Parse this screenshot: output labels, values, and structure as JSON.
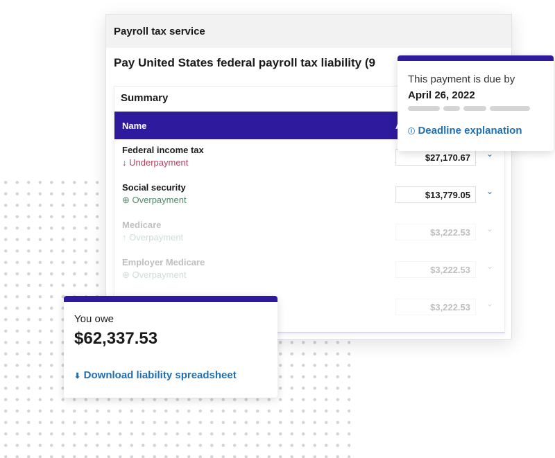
{
  "window": {
    "header": "Payroll tax service",
    "title": "Pay United States federal payroll tax liability (9"
  },
  "summary": {
    "heading": "Summary",
    "columns": [
      "Name",
      "A"
    ],
    "rows": [
      {
        "name": "Federal income tax",
        "status": "Underpayment",
        "status_icon": "arrow-down-icon",
        "amount": "$27,170.67",
        "enabled": true
      },
      {
        "name": "Social security",
        "status": "Overpayment",
        "status_icon": "plus-circle-icon",
        "amount": "$13,779.05",
        "enabled": true
      },
      {
        "name": "Medicare",
        "status": "Overpayment",
        "status_icon": "arrow-up-icon",
        "amount": "$3,222.53",
        "enabled": false
      },
      {
        "name": "Employer Medicare",
        "status": "Overpayment",
        "status_icon": "plus-circle-icon",
        "amount": "$3,222.53",
        "enabled": false
      },
      {
        "name": "",
        "status": "",
        "amount": "$3,222.53",
        "enabled": false
      }
    ]
  },
  "due": {
    "label": "This payment is due by",
    "date": "April 26, 2022",
    "link": "Deadline explanation"
  },
  "owe": {
    "label": "You owe",
    "amount": "$62,337.53",
    "link": "Download liability spreadsheet"
  },
  "colors": {
    "accent": "#2e1a9d",
    "link": "#1f6fb2",
    "under": "#b3405a",
    "over": "#4d8a6a"
  }
}
